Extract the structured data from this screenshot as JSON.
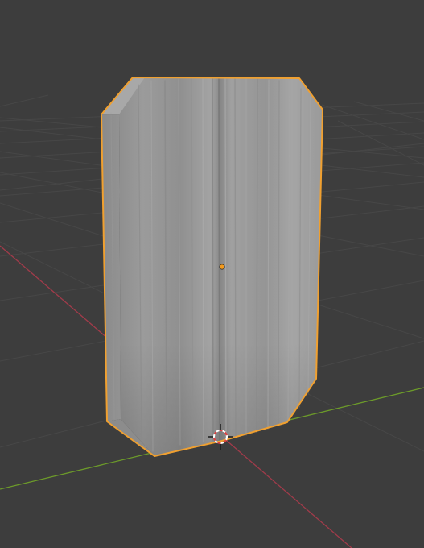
{
  "viewport": {
    "name": "3D Viewport",
    "background_color": "#3d3d3d",
    "grid_line_color": "#474747",
    "x_axis_color": "#a13b4a",
    "y_axis_color": "#6c9a2a"
  },
  "scene": {
    "selected_object": {
      "shape": "beveled-box",
      "material_color": "#9a9a9a",
      "selection_outline_color": "#f0a030",
      "is_selected": true,
      "origin_point_color": "#f29a1e"
    },
    "cursor": {
      "icon": "3d-cursor-icon",
      "ring_colors": [
        "#ffffff",
        "#e04040"
      ]
    }
  }
}
